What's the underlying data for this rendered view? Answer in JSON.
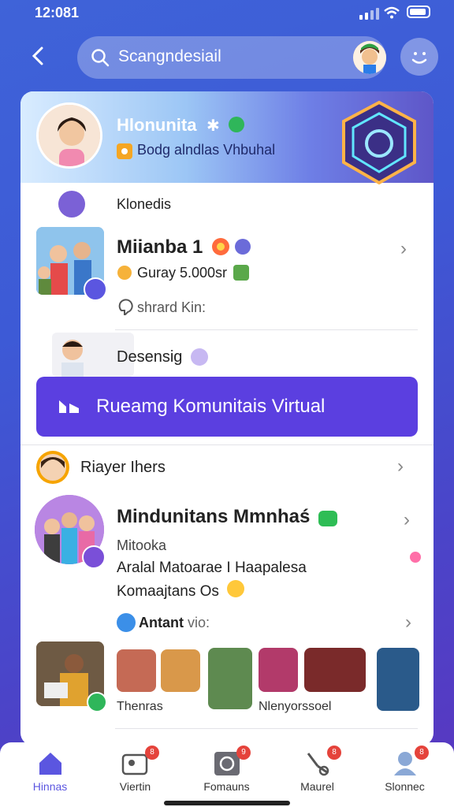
{
  "status_bar": {
    "time": "12:08",
    "time_suffix": "1"
  },
  "header": {
    "search_text": "Scangndesiail"
  },
  "profile": {
    "name": "Hlonunita",
    "subtitle": "Bodg alndlas Vhbuhal"
  },
  "sections": {
    "s1_label": "Klonedis",
    "item1": {
      "title": "Miianba 1",
      "meta": "Guray 5.000sr",
      "note": "shrard Kin:"
    },
    "s2_label": "Desensig",
    "cta_label": "Rueamg Komunitais Virtual",
    "s3_label": "Riayer Ihers",
    "item2": {
      "title": "Mindunitans Mmnhaś",
      "line1": "Mitooka",
      "line2": "Aralal Matoarae I Haapalesa",
      "line3": "Komaajtans Os"
    },
    "s4_label": "Antant",
    "s4_suffix": "vio:",
    "gallery_label_left": "Thenras",
    "gallery_label_right": "Nlenyorssoel"
  },
  "nav": [
    {
      "label": "Hinnas",
      "active": true
    },
    {
      "label": "Viertin",
      "badge": "8"
    },
    {
      "label": "Fomauns",
      "badge": "9"
    },
    {
      "label": "Maurel",
      "badge": "8"
    },
    {
      "label": "Slonnec",
      "badge": "8"
    }
  ],
  "colors": {
    "accent": "#5b3fe0",
    "badge": "#e5433b",
    "active_nav": "#5b56e0"
  }
}
